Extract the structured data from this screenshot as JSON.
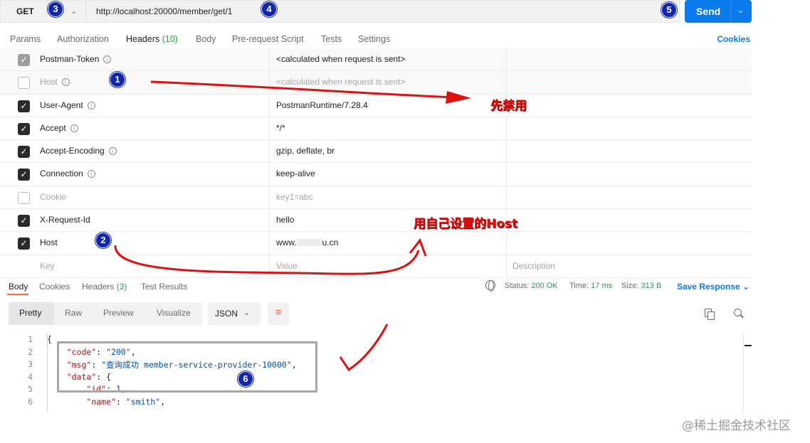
{
  "request": {
    "method": "GET",
    "url": "http://localhost:20000/member/get/1",
    "send_label": "Send"
  },
  "tabs": {
    "params": "Params",
    "authorization": "Authorization",
    "headers": "Headers",
    "headers_count": "(10)",
    "body": "Body",
    "prerequest": "Pre-request Script",
    "tests": "Tests",
    "settings": "Settings",
    "cookies": "Cookies"
  },
  "headers": [
    {
      "key": "Postman-Token",
      "value": "<calculated when request is sent>",
      "state": "auto"
    },
    {
      "key": "Host",
      "value": "<calculated when request is sent>",
      "state": "off"
    },
    {
      "key": "User-Agent",
      "value": "PostmanRuntime/7.28.4",
      "state": "on"
    },
    {
      "key": "Accept",
      "value": "*/*",
      "state": "on"
    },
    {
      "key": "Accept-Encoding",
      "value": "gzip, deflate, br",
      "state": "on"
    },
    {
      "key": "Connection",
      "value": "keep-alive",
      "state": "on"
    },
    {
      "key": "Cookie",
      "value": "key1=abc",
      "state": "off"
    },
    {
      "key": "X-Request-Id",
      "value": "hello",
      "state": "on"
    },
    {
      "key": "Host",
      "value_prefix": "www.",
      "value_suffix": "u.cn",
      "state": "on"
    }
  ],
  "new_row": {
    "key": "Key",
    "value": "Value",
    "description": "Description"
  },
  "response": {
    "tabs": {
      "body": "Body",
      "cookies": "Cookies",
      "headers": "Headers",
      "headers_count": "(3)",
      "test_results": "Test Results"
    },
    "status_label": "Status:",
    "status_value": "200 OK",
    "time_label": "Time:",
    "time_value": "17 ms",
    "size_label": "Size:",
    "size_value": "313 B",
    "save_label": "Save Response"
  },
  "viewer": {
    "pretty": "Pretty",
    "raw": "Raw",
    "preview": "Preview",
    "visualize": "Visualize",
    "format": "JSON"
  },
  "code": {
    "line_numbers": [
      "1",
      "2",
      "3",
      "4",
      "5",
      "6"
    ],
    "l1": "{",
    "l2_key": "\"code\"",
    "l2_val": "\"200\"",
    "l3_key": "\"msg\"",
    "l3_val": "\"查询成功 member-service-provider-10000\"",
    "l4_key": "\"data\"",
    "l4_val": "{",
    "l5_key": "\"id\"",
    "l5_val": "1",
    "l6_key": "\"name\"",
    "l6_val": "\"smith\""
  },
  "annotations": {
    "badges": [
      "1",
      "2",
      "3",
      "4",
      "5",
      "6"
    ],
    "text_disable": "先禁用",
    "text_custom_host": "用自己设置的Host",
    "color": "#e01010"
  },
  "watermark": "@稀土掘金技术社区"
}
